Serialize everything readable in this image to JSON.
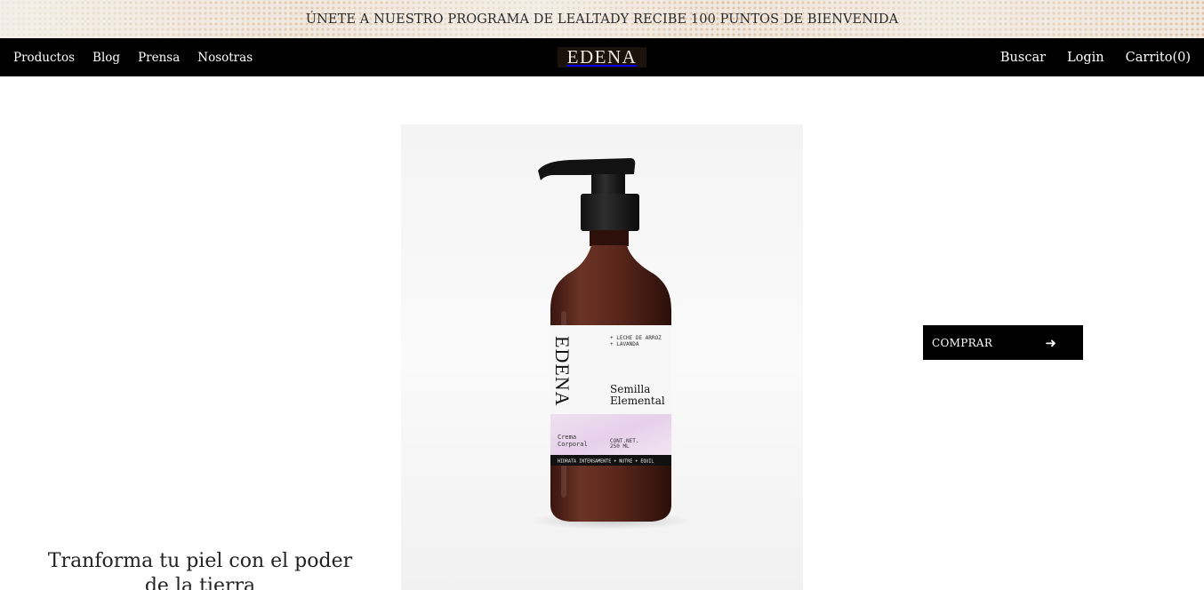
{
  "promo": {
    "text": "ÚNETE A NUESTRO PROGRAMA DE LEALTADY RECIBE 100 PUNTOS DE BIENVENIDA"
  },
  "nav": {
    "left_links": [
      "Productos",
      "Blog",
      "Prensa",
      "Nosotras"
    ],
    "logo": "EDENA",
    "search": "Buscar",
    "login": "Login",
    "cart": "Carrito(0)"
  },
  "product": {
    "brand": "EDENA",
    "ingredients": [
      "+ LECHE DE ARROZ",
      "+ LAVANDA"
    ],
    "name_line1": "Semilla",
    "name_line2": "Elemental",
    "type_line1": "Crema",
    "type_line2": "Corporal",
    "content_line1": "CONT.NET.",
    "content_line2": "250 ML",
    "band_text": "HIDRATA INTENSAMENTE + NUTRE + EQUIL"
  },
  "cta": {
    "label": "COMPRAR",
    "icon": "arrow-right-icon"
  },
  "tagline": "Tranforma tu piel con el poder de la tierra",
  "colors": {
    "promo_bg": "#efe6dc",
    "nav_bg": "#000000",
    "logo_bg": "#1c120c",
    "bottle": "#5a2a20"
  }
}
